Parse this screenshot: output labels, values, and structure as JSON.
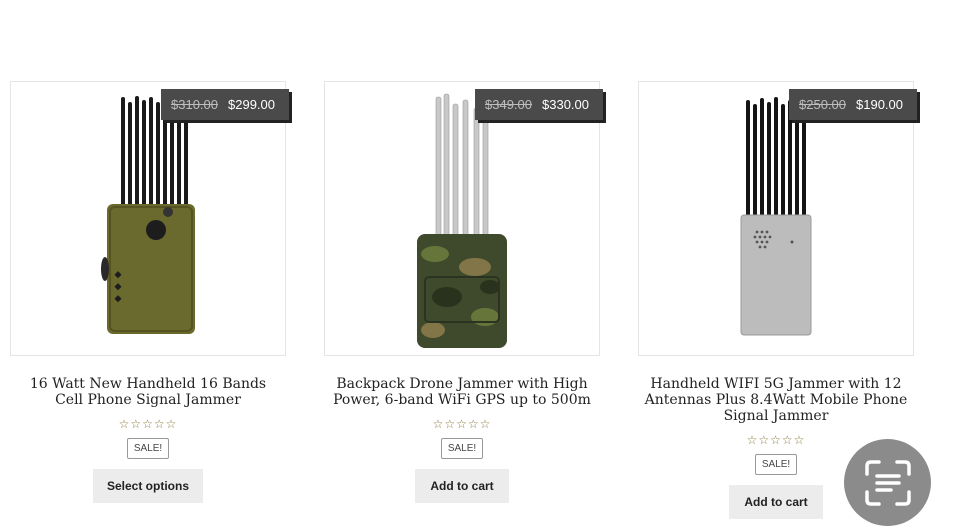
{
  "products": [
    {
      "old_price": "$310.00",
      "new_price": "$299.00",
      "title": "16 Watt New Handheld 16 Bands Cell Phone Signal Jammer",
      "rating_stars": "☆☆☆☆☆",
      "badge": "SALE!",
      "button": "Select options"
    },
    {
      "old_price": "$349.00",
      "new_price": "$330.00",
      "title": "Backpack Drone Jammer with High Power, 6-band WiFi GPS up to 500m",
      "rating_stars": "☆☆☆☆☆",
      "badge": "SALE!",
      "button": "Add to cart"
    },
    {
      "old_price": "$250.00",
      "new_price": "$190.00",
      "title": "Handheld WIFI 5G Jammer with 12 Antennas Plus 8.4Watt Mobile Phone Signal Jammer",
      "rating_stars": "☆☆☆☆☆",
      "badge": "SALE!",
      "button": "Add to cart"
    }
  ],
  "floating_button": {
    "icon": "scan-text-icon"
  },
  "colors": {
    "price_tag": "#4a4a4a",
    "button_bg": "#ececec",
    "fab_bg": "#8b8b8b",
    "star": "#8a7a3a"
  }
}
